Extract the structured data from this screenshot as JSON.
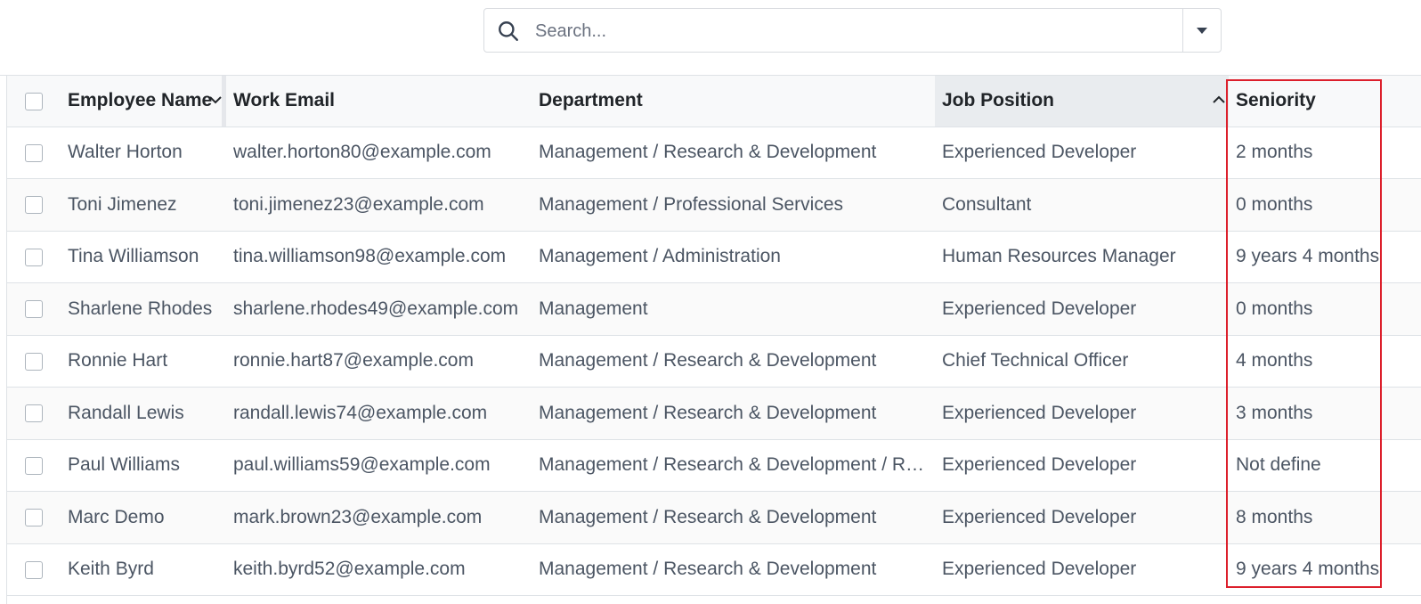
{
  "search": {
    "placeholder": "Search..."
  },
  "columns": {
    "employee_name": "Employee Name",
    "work_email": "Work Email",
    "department": "Department",
    "job_position": "Job Position",
    "seniority": "Seniority"
  },
  "rows": [
    {
      "name": "Walter Horton",
      "email": "walter.horton80@example.com",
      "department": "Management / Research & Development",
      "job": "Experienced Developer",
      "seniority": "2 months"
    },
    {
      "name": "Toni Jimenez",
      "email": "toni.jimenez23@example.com",
      "department": "Management / Professional Services",
      "job": "Consultant",
      "seniority": "0 months"
    },
    {
      "name": "Tina Williamson",
      "email": "tina.williamson98@example.com",
      "department": "Management / Administration",
      "job": "Human Resources Manager",
      "seniority": "9 years 4 months"
    },
    {
      "name": "Sharlene Rhodes",
      "email": "sharlene.rhodes49@example.com",
      "department": "Management",
      "job": "Experienced Developer",
      "seniority": "0 months"
    },
    {
      "name": "Ronnie Hart",
      "email": "ronnie.hart87@example.com",
      "department": "Management / Research & Development",
      "job": "Chief Technical Officer",
      "seniority": "4 months"
    },
    {
      "name": "Randall Lewis",
      "email": "randall.lewis74@example.com",
      "department": "Management / Research & Development",
      "job": "Experienced Developer",
      "seniority": "3 months"
    },
    {
      "name": "Paul Williams",
      "email": "paul.williams59@example.com",
      "department": "Management / Research & Development / R&...",
      "job": "Experienced Developer",
      "seniority": "Not define"
    },
    {
      "name": "Marc Demo",
      "email": "mark.brown23@example.com",
      "department": "Management / Research & Development",
      "job": "Experienced Developer",
      "seniority": "8 months"
    },
    {
      "name": "Keith Byrd",
      "email": "keith.byrd52@example.com",
      "department": "Management / Research & Development",
      "job": "Experienced Developer",
      "seniority": "9 years 4 months"
    }
  ],
  "colors": {
    "highlight": "#dc1f2b",
    "header_bg": "#f8f9fa",
    "sorted_header_bg": "#e9ecef"
  },
  "icons": {
    "search": "search-icon",
    "dropdown": "caret-down-icon",
    "name_sort": "chevron-down-icon",
    "job_sort": "chevron-up-icon"
  }
}
